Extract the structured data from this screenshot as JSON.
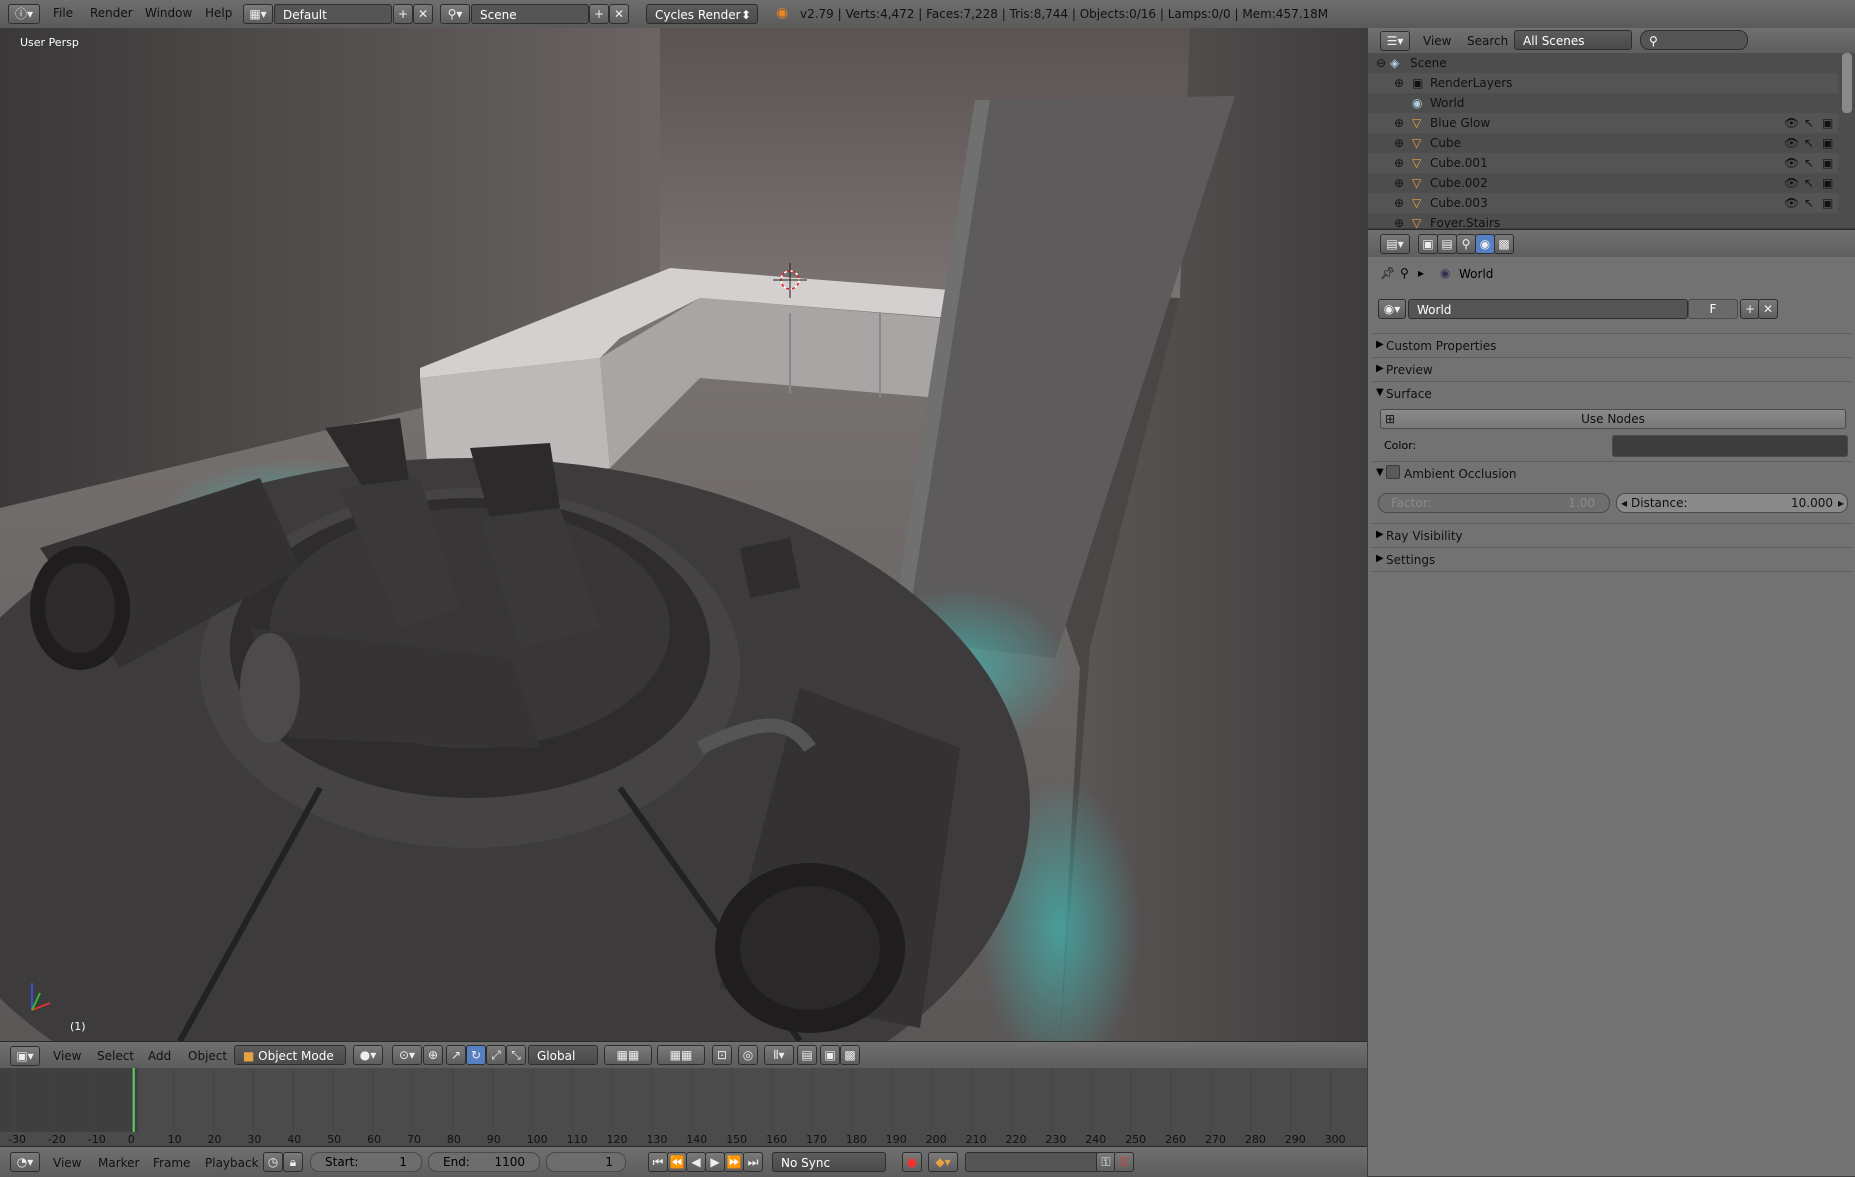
{
  "topbar": {
    "menus": [
      "File",
      "Render",
      "Window",
      "Help"
    ],
    "layout": "Default",
    "scene": "Scene",
    "engine": "Cycles Render",
    "stats": "v2.79 | Verts:4,472 | Faces:7,228 | Tris:8,744 | Objects:0/16 | Lamps:0/0 | Mem:457.18M"
  },
  "viewport": {
    "view_label": "User Persp",
    "frame_label": "(1)"
  },
  "view_header": {
    "menus": [
      "View",
      "Select",
      "Add",
      "Object"
    ],
    "mode": "Object Mode",
    "orientation": "Global"
  },
  "timeline": {
    "ticks": [
      "-30",
      "-20",
      "-10",
      "0",
      "10",
      "20",
      "30",
      "40",
      "50",
      "60",
      "70",
      "80",
      "90",
      "100",
      "110",
      "120",
      "130",
      "140",
      "150",
      "160",
      "170",
      "180",
      "190",
      "200",
      "210",
      "220",
      "230",
      "240",
      "250",
      "260",
      "270",
      "280",
      "290",
      "300"
    ],
    "current_frame": 0,
    "menus": [
      "View",
      "Marker",
      "Frame",
      "Playback"
    ],
    "start_label": "Start:",
    "start_value": "1",
    "end_label": "End:",
    "end_value": "1100",
    "frame_value": "1",
    "sync": "No Sync"
  },
  "outliner": {
    "menus": [
      "View",
      "Search"
    ],
    "filter": "All Scenes",
    "rows": [
      {
        "label": "Scene"
      },
      {
        "label": "RenderLayers"
      },
      {
        "label": "World"
      },
      {
        "label": "Blue Glow"
      },
      {
        "label": "Cube"
      },
      {
        "label": "Cube.001"
      },
      {
        "label": "Cube.002"
      },
      {
        "label": "Cube.003"
      },
      {
        "label": "Foyer.Stairs"
      }
    ]
  },
  "properties": {
    "breadcrumb": "World",
    "datablock_name": "World",
    "fake_user": "F",
    "panels": {
      "custom_properties": "Custom Properties",
      "preview": "Preview",
      "surface": "Surface",
      "use_nodes": "Use Nodes",
      "color_label": "Color:",
      "ambient_occlusion": "Ambient Occlusion",
      "factor_label": "Factor:",
      "factor_value": "1.00",
      "distance_label": "Distance:",
      "distance_value": "10.000",
      "ray_visibility": "Ray Visibility",
      "settings": "Settings"
    }
  },
  "colors": {
    "accent_teal": "#3fb9b5",
    "playhead": "#5fd35f",
    "panel_bg": "#727272",
    "header_bg": "#6a6a6a"
  }
}
